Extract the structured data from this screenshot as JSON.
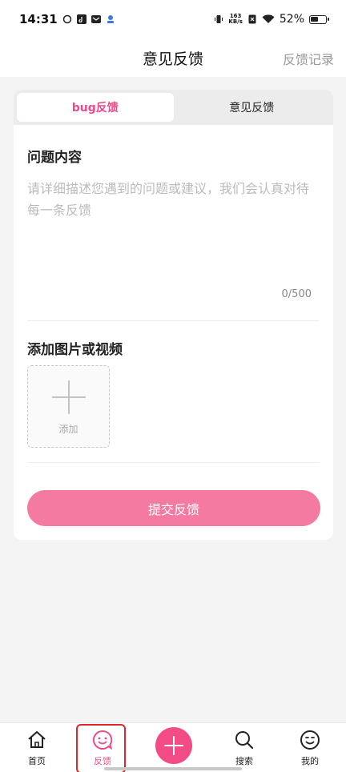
{
  "status_bar": {
    "time": "14:31",
    "net_speed_value": "163",
    "net_speed_unit": "KB/s",
    "battery": "52%",
    "battery_level": 0.52
  },
  "header": {
    "title": "意见反馈",
    "action": "反馈记录"
  },
  "tabs": [
    {
      "label": "bug反馈",
      "active": true
    },
    {
      "label": "意见反馈",
      "active": false
    }
  ],
  "problem": {
    "title": "问题内容",
    "placeholder": "请详细描述您遇到的问题或建议，我们会认真对待每一条反馈",
    "counter": "0/500"
  },
  "media": {
    "title": "添加图片或视频",
    "add_label": "添加"
  },
  "submit_label": "提交反馈",
  "nav": {
    "items": [
      {
        "label": "首页",
        "icon": "home-icon"
      },
      {
        "label": "反馈",
        "icon": "feedback-smile-icon",
        "active": true
      },
      {
        "label": "",
        "icon": "plus-icon"
      },
      {
        "label": "搜索",
        "icon": "search-icon"
      },
      {
        "label": "我的",
        "icon": "profile-smile-icon"
      }
    ]
  },
  "colors": {
    "accent": "#e84c8a",
    "button": "#f57aa2",
    "fab": "#f24b86",
    "highlight": "#e0262b"
  }
}
